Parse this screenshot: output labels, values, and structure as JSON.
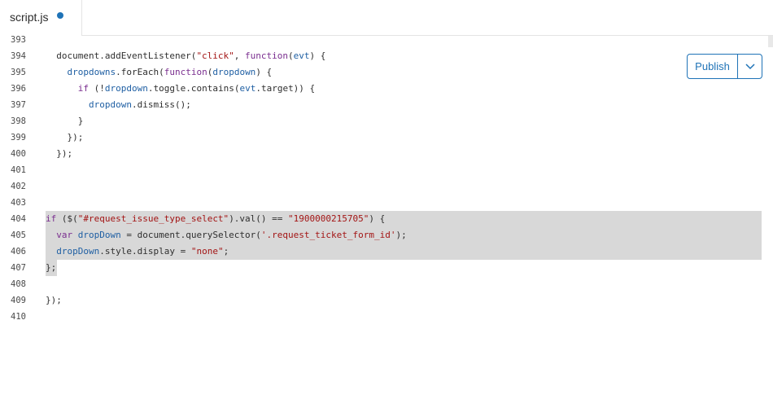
{
  "tab": {
    "filename": "script.js",
    "unsaved": true
  },
  "toolbar": {
    "publish_label": "Publish",
    "dropdown_icon": "chevron-down-icon"
  },
  "colors": {
    "accent": "#1f73b7",
    "highlight": "#d8d8d8",
    "keyword": "#7a2e8f",
    "string": "#a31515",
    "identifier": "#1f5fa3"
  },
  "editor": {
    "lines": [
      {
        "num": "393",
        "highlight": "none",
        "tokens": []
      },
      {
        "num": "394",
        "highlight": "none",
        "tokens": [
          {
            "t": "  document.addEventListener(",
            "c": "plain"
          },
          {
            "t": "\"click\"",
            "c": "str"
          },
          {
            "t": ", ",
            "c": "plain"
          },
          {
            "t": "function",
            "c": "kw"
          },
          {
            "t": "(",
            "c": "plain"
          },
          {
            "t": "evt",
            "c": "var"
          },
          {
            "t": ") {",
            "c": "plain"
          }
        ]
      },
      {
        "num": "395",
        "highlight": "none",
        "tokens": [
          {
            "t": "    ",
            "c": "plain"
          },
          {
            "t": "dropdowns",
            "c": "var"
          },
          {
            "t": ".forEach(",
            "c": "plain"
          },
          {
            "t": "function",
            "c": "kw"
          },
          {
            "t": "(",
            "c": "plain"
          },
          {
            "t": "dropdown",
            "c": "var"
          },
          {
            "t": ") {",
            "c": "plain"
          }
        ]
      },
      {
        "num": "396",
        "highlight": "none",
        "tokens": [
          {
            "t": "      ",
            "c": "plain"
          },
          {
            "t": "if",
            "c": "kw"
          },
          {
            "t": " (!",
            "c": "plain"
          },
          {
            "t": "dropdown",
            "c": "var"
          },
          {
            "t": ".toggle.contains(",
            "c": "plain"
          },
          {
            "t": "evt",
            "c": "var"
          },
          {
            "t": ".target)) {",
            "c": "plain"
          }
        ]
      },
      {
        "num": "397",
        "highlight": "none",
        "tokens": [
          {
            "t": "        ",
            "c": "plain"
          },
          {
            "t": "dropdown",
            "c": "var"
          },
          {
            "t": ".dismiss();",
            "c": "plain"
          }
        ]
      },
      {
        "num": "398",
        "highlight": "none",
        "tokens": [
          {
            "t": "      }",
            "c": "plain"
          }
        ]
      },
      {
        "num": "399",
        "highlight": "none",
        "tokens": [
          {
            "t": "    });",
            "c": "plain"
          }
        ]
      },
      {
        "num": "400",
        "highlight": "none",
        "tokens": [
          {
            "t": "  });",
            "c": "plain"
          }
        ]
      },
      {
        "num": "401",
        "highlight": "none",
        "tokens": []
      },
      {
        "num": "402",
        "highlight": "none",
        "tokens": []
      },
      {
        "num": "403",
        "highlight": "none",
        "tokens": []
      },
      {
        "num": "404",
        "highlight": "full",
        "tokens": [
          {
            "t": "if",
            "c": "kw"
          },
          {
            "t": " ($(",
            "c": "plain"
          },
          {
            "t": "\"#request_issue_type_select\"",
            "c": "str"
          },
          {
            "t": ").val() == ",
            "c": "plain"
          },
          {
            "t": "\"1900000215705\"",
            "c": "str"
          },
          {
            "t": ") {",
            "c": "plain"
          }
        ]
      },
      {
        "num": "405",
        "highlight": "full",
        "tokens": [
          {
            "t": "  ",
            "c": "plain"
          },
          {
            "t": "var",
            "c": "kw"
          },
          {
            "t": " ",
            "c": "plain"
          },
          {
            "t": "dropDown",
            "c": "var"
          },
          {
            "t": " = document.querySelector(",
            "c": "plain"
          },
          {
            "t": "'.request_ticket_form_id'",
            "c": "str"
          },
          {
            "t": ");",
            "c": "plain"
          }
        ]
      },
      {
        "num": "406",
        "highlight": "full",
        "tokens": [
          {
            "t": "  ",
            "c": "plain"
          },
          {
            "t": "dropDown",
            "c": "var"
          },
          {
            "t": ".style.display = ",
            "c": "plain"
          },
          {
            "t": "\"none\"",
            "c": "str"
          },
          {
            "t": ";",
            "c": "plain"
          }
        ]
      },
      {
        "num": "407",
        "highlight": "short",
        "tokens": [
          {
            "t": "};",
            "c": "plain"
          }
        ]
      },
      {
        "num": "408",
        "highlight": "none",
        "tokens": []
      },
      {
        "num": "409",
        "highlight": "none",
        "tokens": [
          {
            "t": "});",
            "c": "plain"
          }
        ]
      },
      {
        "num": "410",
        "highlight": "none",
        "tokens": []
      }
    ]
  }
}
